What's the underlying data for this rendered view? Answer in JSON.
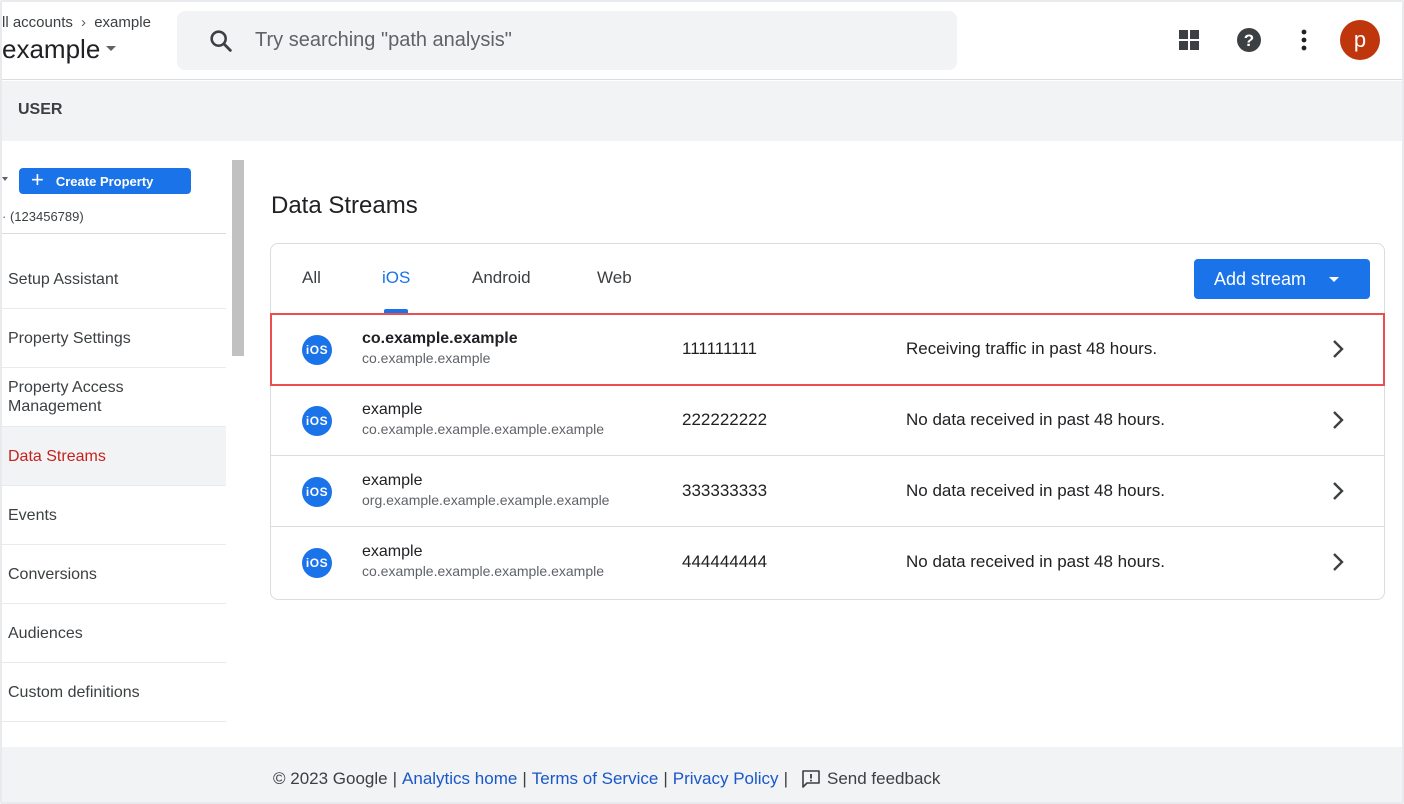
{
  "header": {
    "breadcrumb": [
      "ll accounts",
      "example"
    ],
    "property_name": "example",
    "search_placeholder": "Try searching \"path analysis\"",
    "avatar_letter": "p"
  },
  "band": {
    "label": "USER"
  },
  "sidebar": {
    "create_property_label": "Create Property",
    "property_id": "(123456789)",
    "items": [
      {
        "label": "Setup Assistant",
        "active": false
      },
      {
        "label": "Property Settings",
        "active": false
      },
      {
        "label": "Property Access Management",
        "active": false
      },
      {
        "label": "Data Streams",
        "active": true
      },
      {
        "label": "Events",
        "active": false
      },
      {
        "label": "Conversions",
        "active": false
      },
      {
        "label": "Audiences",
        "active": false
      },
      {
        "label": "Custom definitions",
        "active": false
      }
    ]
  },
  "main": {
    "title": "Data Streams",
    "tabs": [
      {
        "label": "All",
        "active": false
      },
      {
        "label": "iOS",
        "active": true
      },
      {
        "label": "Android",
        "active": false
      },
      {
        "label": "Web",
        "active": false
      }
    ],
    "add_stream_label": "Add stream",
    "ios_badge": "iOS",
    "streams": [
      {
        "name": "co.example.example",
        "bundle": "co.example.example",
        "id": "111111111",
        "status": "Receiving traffic in past 48 hours.",
        "highlighted": true
      },
      {
        "name": "example",
        "bundle": "co.example.example.example.example",
        "id": "222222222",
        "status": "No data received in past 48 hours.",
        "highlighted": false
      },
      {
        "name": "example",
        "bundle": "org.example.example.example.example",
        "id": "333333333",
        "status": "No data received in past 48 hours.",
        "highlighted": false
      },
      {
        "name": "example",
        "bundle": "co.example.example.example.example",
        "id": "444444444",
        "status": "No data received in past 48 hours.",
        "highlighted": false
      }
    ]
  },
  "footer": {
    "copyright": "© 2023 Google",
    "links": [
      "Analytics home",
      "Terms of Service",
      "Privacy Policy"
    ],
    "feedback": "Send feedback"
  },
  "colors": {
    "accent": "#1a73e8",
    "active_nav": "#c5221f",
    "highlight_outline": "#e94f4f",
    "avatar": "#bf360c"
  },
  "icons": [
    "search-icon",
    "apps-grid-icon",
    "help-icon",
    "more-vert-icon",
    "plus-icon",
    "ios-icon",
    "chevron-right-icon",
    "feedback-icon",
    "caret-down-icon"
  ]
}
